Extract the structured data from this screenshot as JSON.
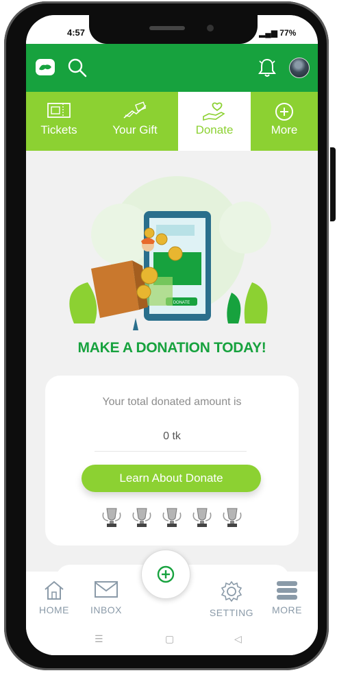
{
  "status": {
    "time": "4:57",
    "battery": "77%"
  },
  "topbar": {
    "logo_icon": "app-logo-icon",
    "search_icon": "search-icon",
    "bell_icon": "bell-icon",
    "avatar_icon": "user-avatar"
  },
  "tabs": [
    {
      "label": "Tickets",
      "icon": "ticket-icon"
    },
    {
      "label": "Your Gift",
      "icon": "gift-icon"
    },
    {
      "label": "Donate",
      "icon": "donate-heart-hand-icon",
      "active": true
    },
    {
      "label": "More",
      "icon": "plus-circle-icon"
    }
  ],
  "hero": {
    "button_text": "DONATE"
  },
  "headline": "MAKE A DONATION TODAY!",
  "donation_card": {
    "label": "Your total donated amount is",
    "amount": "0 tk",
    "button_label": "Learn About Donate",
    "trophy_count": 5
  },
  "bottom_nav": [
    {
      "label": "HOME",
      "icon": "home-icon"
    },
    {
      "label": "INBOX",
      "icon": "mail-icon"
    },
    {
      "label": "SETTING",
      "icon": "gear-icon"
    },
    {
      "label": "MORE",
      "icon": "stack-icon"
    }
  ],
  "colors": {
    "primary_green": "#17a23e",
    "light_green": "#8cd132",
    "background": "#f1f1f1"
  }
}
